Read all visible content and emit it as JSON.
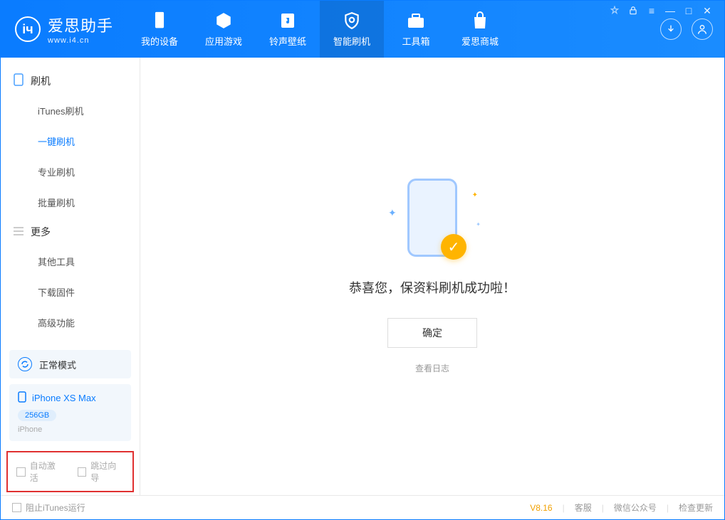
{
  "app": {
    "name": "爱思助手",
    "url": "www.i4.cn"
  },
  "tabs": {
    "device": "我的设备",
    "apps": "应用游戏",
    "ring": "铃声壁纸",
    "flash": "智能刷机",
    "tools": "工具箱",
    "store": "爱思商城"
  },
  "sidebar": {
    "group_flash": "刷机",
    "items_flash": {
      "itunes": "iTunes刷机",
      "onekey": "一键刷机",
      "pro": "专业刷机",
      "batch": "批量刷机"
    },
    "group_more": "更多",
    "items_more": {
      "other": "其他工具",
      "firmware": "下载固件",
      "advanced": "高级功能"
    }
  },
  "mode": {
    "label": "正常模式"
  },
  "device": {
    "name": "iPhone XS Max",
    "storage": "256GB",
    "type": "iPhone"
  },
  "opts": {
    "auto_activate": "自动激活",
    "skip_guide": "跳过向导"
  },
  "main": {
    "message": "恭喜您，保资料刷机成功啦！",
    "ok": "确定",
    "view_log": "查看日志"
  },
  "footer": {
    "block_itunes": "阻止iTunes运行",
    "version": "V8.16",
    "support": "客服",
    "wechat": "微信公众号",
    "update": "检查更新"
  }
}
